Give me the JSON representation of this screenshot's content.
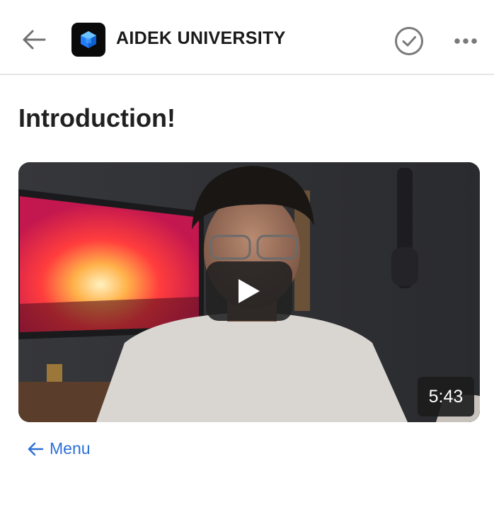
{
  "header": {
    "title": "AIDEK UNIVERSITY",
    "back_icon": "arrow-left-icon",
    "logo_icon": "cube-logo-icon",
    "complete_icon": "check-circle-icon",
    "more_icon": "more-horizontal-icon"
  },
  "lesson": {
    "title": "Introduction!"
  },
  "video": {
    "duration": "5:43",
    "play_icon": "play-icon"
  },
  "footer": {
    "menu_label": "Menu",
    "menu_icon": "arrow-left-icon"
  },
  "colors": {
    "link": "#2d6fd6",
    "logo_bg": "#0a0a0a",
    "logo_accent": "#2b8cff",
    "icon_gray": "#7a7a7a"
  }
}
